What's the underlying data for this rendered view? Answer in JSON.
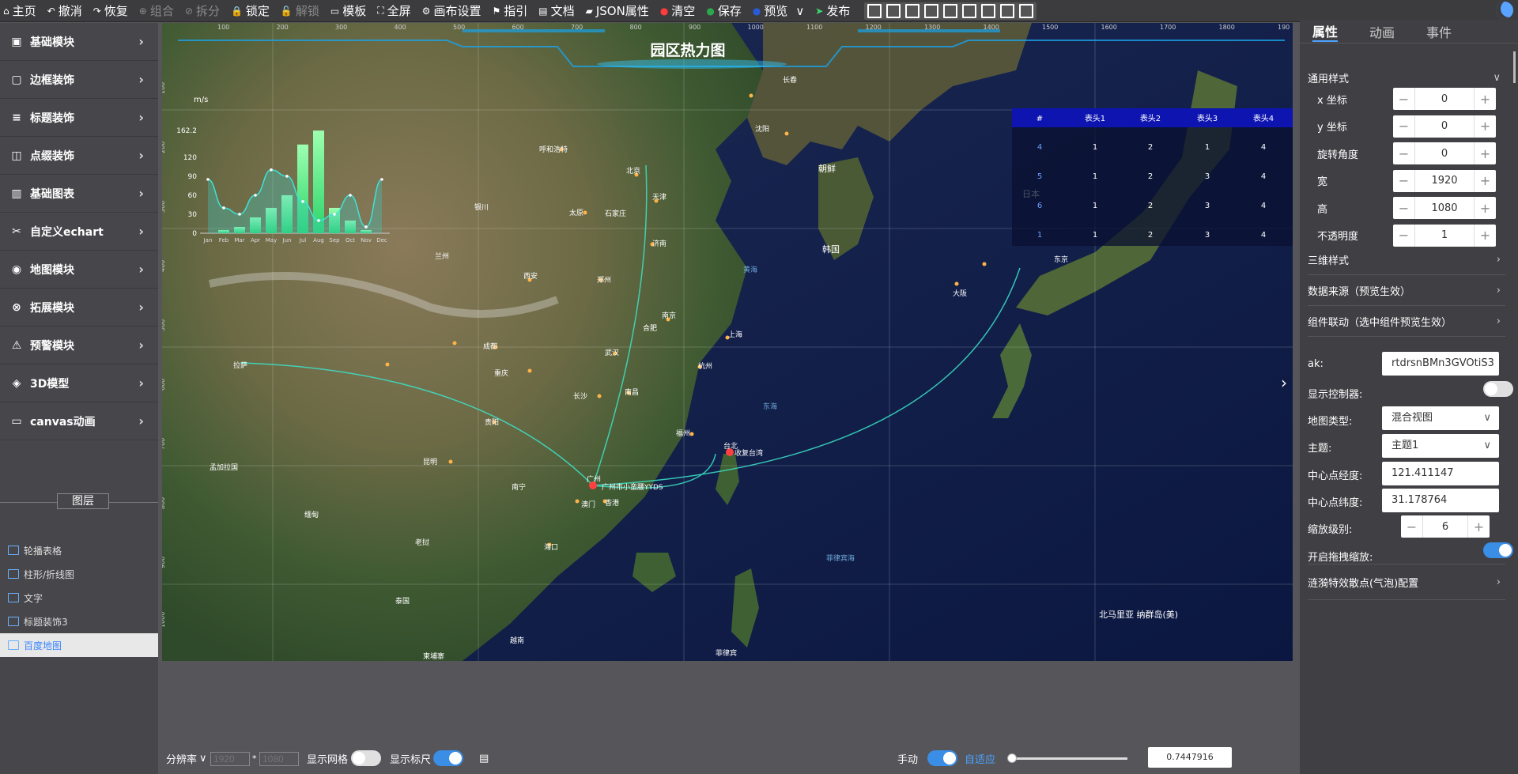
{
  "toolbar": {
    "items": [
      {
        "label": "主页",
        "icon": "home-icon",
        "glyph": "⌂"
      },
      {
        "label": "撤消",
        "icon": "undo-icon",
        "glyph": "↶"
      },
      {
        "label": "恢复",
        "icon": "redo-icon",
        "glyph": "↷"
      },
      {
        "label": "组合",
        "icon": "group-icon",
        "glyph": "⊕",
        "disabled": true
      },
      {
        "label": "拆分",
        "icon": "split-icon",
        "glyph": "⊘",
        "disabled": true
      },
      {
        "label": "锁定",
        "icon": "lock-icon",
        "glyph": "🔒"
      },
      {
        "label": "解锁",
        "icon": "unlock-icon",
        "glyph": "🔓",
        "disabled": true
      },
      {
        "label": "模板",
        "icon": "template-icon",
        "glyph": "▭"
      },
      {
        "label": "全屏",
        "icon": "fullscreen-icon",
        "glyph": "⛶"
      },
      {
        "label": "画布设置",
        "icon": "gear-icon",
        "glyph": "⚙"
      },
      {
        "label": "指引",
        "icon": "flag-icon",
        "glyph": "⚑"
      },
      {
        "label": "文档",
        "icon": "document-icon",
        "glyph": "▤"
      },
      {
        "label": "JSON属性",
        "icon": "folder-icon",
        "glyph": "▰"
      },
      {
        "label": "清空",
        "icon": "clear-icon",
        "glyph": "●",
        "color": "#ff3b3b"
      },
      {
        "label": "保存",
        "icon": "save-icon",
        "glyph": "●",
        "color": "#2aa84a"
      },
      {
        "label": "预览",
        "icon": "preview-icon",
        "glyph": "●",
        "color": "#2a5bd7"
      },
      {
        "label": "发布",
        "icon": "publish-icon",
        "glyph": "➤",
        "color": "#3cdc6a"
      }
    ],
    "preview_chevron": "∨"
  },
  "leftnav": {
    "items": [
      {
        "label": "基础模块",
        "icon": "module-icon",
        "glyph": "▣"
      },
      {
        "label": "边框装饰",
        "icon": "border-icon",
        "glyph": "▢"
      },
      {
        "label": "标题装饰",
        "icon": "title-icon",
        "glyph": "≡"
      },
      {
        "label": "点缀装饰",
        "icon": "decor-icon",
        "glyph": "◫"
      },
      {
        "label": "基础图表",
        "icon": "chart-icon",
        "glyph": "▥"
      },
      {
        "label": "自定义echart",
        "icon": "custom-icon",
        "glyph": "✂"
      },
      {
        "label": "地图模块",
        "icon": "map-icon",
        "glyph": "◉"
      },
      {
        "label": "拓展模块",
        "icon": "extend-icon",
        "glyph": "⊗"
      },
      {
        "label": "预警模块",
        "icon": "alert-icon",
        "glyph": "⚠"
      },
      {
        "label": "3D模型",
        "icon": "cube-icon",
        "glyph": "◈"
      },
      {
        "label": "canvas动画",
        "icon": "canvas-icon",
        "glyph": "▭"
      }
    ],
    "arrow": "›",
    "layers_title": "图层",
    "layers": [
      {
        "label": "轮播表格",
        "selected": false
      },
      {
        "label": "柱形/折线图",
        "selected": false
      },
      {
        "label": "文字",
        "selected": false
      },
      {
        "label": "标题装饰3",
        "selected": false
      },
      {
        "label": "百度地图",
        "selected": true
      }
    ]
  },
  "canvas": {
    "title": "园区热力图",
    "ruler_top": [
      "100",
      "200",
      "300",
      "400",
      "500",
      "600",
      "700",
      "800",
      "900",
      "1000",
      "1100",
      "1200",
      "1300",
      "1400",
      "1500",
      "1600",
      "1700",
      "1800",
      "190"
    ],
    "ruler_left": [
      "100",
      "200",
      "300",
      "400",
      "500",
      "600",
      "700",
      "800",
      "900",
      "1000"
    ],
    "table": {
      "headers": [
        "#",
        "表头1",
        "表头2",
        "表头3",
        "表头4"
      ],
      "rows": [
        [
          "4",
          "1",
          "2",
          "1",
          "4"
        ],
        [
          "5",
          "1",
          "2",
          "3",
          "4"
        ],
        [
          "6",
          "1",
          "2",
          "3",
          "4"
        ],
        [
          "1",
          "1",
          "2",
          "3",
          "4"
        ]
      ]
    },
    "map_labels": {
      "beijing": "北京",
      "tianjin": "天津",
      "shanghai": "上海",
      "hangzhou": "杭州",
      "nanjing": "南京",
      "wuhan": "武汉",
      "chengdu": "成都",
      "chongqing": "重庆",
      "xian": "西安",
      "zhengzhou": "郑州",
      "jinan": "济南",
      "hefei": "合肥",
      "changsha": "长沙",
      "nanchang": "南昌",
      "guiyang": "贵阳",
      "kunming": "昆明",
      "nanning": "南宁",
      "fuzhou": "福州",
      "taibei": "台北",
      "taibei_tag": "收复台湾",
      "guangzhou": "广州",
      "guangzhou_tag": "广州市小蛮腰YYDS",
      "xianggang": "香港",
      "aomen": "澳门",
      "haikou": "海口",
      "lhasa": "拉萨",
      "shenyang": "沈阳",
      "changchun": "长春",
      "hohhot": "呼和浩特",
      "taiyuan": "太原",
      "shijiazhuang": "石家庄",
      "lanzhou": "兰州",
      "yinchuan": "银川",
      "chaoxian": "朝鲜",
      "hanguo": "韩国",
      "riben": "日本",
      "dongjing": "东京",
      "dahan": "大阪",
      "miandian": "缅甸",
      "laowo": "老挝",
      "taiguo": "泰国",
      "yuenan": "越南",
      "jianpuzhai": "柬埔寨",
      "mengjiala": "孟加拉国",
      "feilvbin": "菲律宾",
      "donghai": "东海",
      "huanghai": "黄海",
      "nanhai": "菲律宾海",
      "beimali": "北马里亚\n纳群岛(美)"
    },
    "chart": {
      "ylabel": "m/s",
      "ymax_label": "162.2"
    }
  },
  "chart_data": {
    "type": "bar",
    "categories": [
      "Jan",
      "Feb",
      "Mar",
      "Apr",
      "May",
      "Jun",
      "Jul",
      "Aug",
      "Sep",
      "Oct",
      "Nov",
      "Dec"
    ],
    "series": [
      {
        "values": [
          0,
          5,
          10,
          25,
          40,
          60,
          140,
          162,
          40,
          20,
          5,
          0
        ]
      },
      {
        "values": [
          85,
          40,
          30,
          60,
          100,
          90,
          50,
          20,
          30,
          60,
          10,
          85
        ]
      }
    ],
    "ylim": [
      0,
      162.2
    ],
    "yticks": [
      "0",
      "30",
      "60",
      "90",
      "120",
      "162.2"
    ],
    "ylabel": "m/s"
  },
  "bottombar": {
    "resolution_label": "分辨率",
    "width_placeholder": "1920",
    "height_placeholder": "1080",
    "times": "*",
    "show_grid": "显示网格",
    "show_ruler": "显示标尺",
    "manual": "手动",
    "auto_fit": "自适应",
    "zoom_value": "0.7447916"
  },
  "rightpanel": {
    "tabs": [
      "属性",
      "动画",
      "事件"
    ],
    "general_style": "通用样式",
    "props": [
      {
        "label": "x 坐标",
        "value": "0"
      },
      {
        "label": "y 坐标",
        "value": "0"
      },
      {
        "label": "旋转角度",
        "value": "0"
      },
      {
        "label": "宽",
        "value": "1920"
      },
      {
        "label": "高",
        "value": "1080"
      },
      {
        "label": "不透明度",
        "value": "1"
      }
    ],
    "sections": [
      "三维样式",
      "数据来源（预览生效）",
      "组件联动（选中组件预览生效）"
    ],
    "ak_label": "ak:",
    "ak_value": "rtdrsnBMn3GVOtiS3",
    "show_controller": "显示控制器:",
    "map_type_label": "地图类型:",
    "map_type_value": "混合视图",
    "theme_label": "主题:",
    "theme_value": "主题1",
    "lng_label": "中心点经度:",
    "lng_value": "121.411147",
    "lat_label": "中心点纬度:",
    "lat_value": "31.178764",
    "zoom_label": "缩放级别:",
    "zoom_value": "6",
    "drag_label": "开启拖拽缩放:",
    "last_section": "涟漪特效散点(气泡)配置",
    "colors": {
      "accent": "#3a8ee6",
      "toggle_off": "#d0d0d0"
    }
  }
}
